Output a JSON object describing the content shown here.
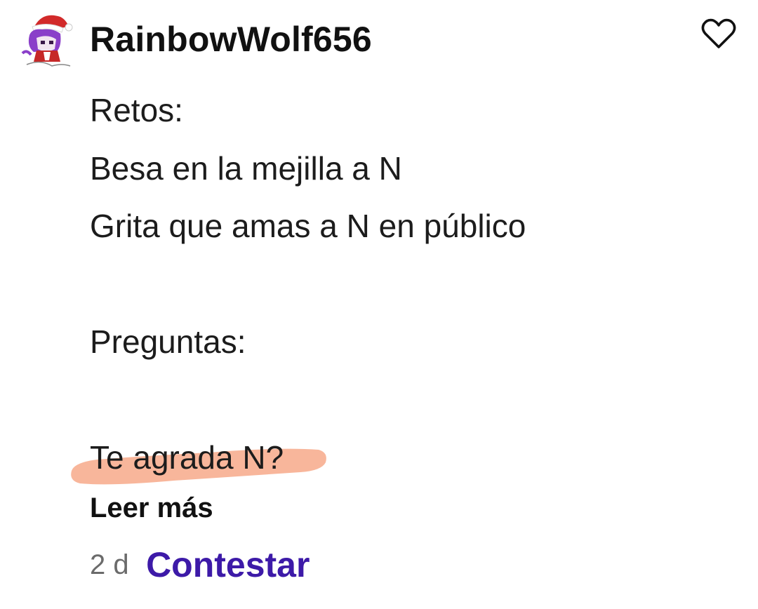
{
  "comment": {
    "author": "RainbowWolf656",
    "avatar_icon": "avatar-character-santa-hat",
    "lines": [
      "Retos:",
      "Besa en la mejilla a N",
      "Grita que amas a N en público",
      "",
      "Preguntas:",
      "",
      "Te agrada N?"
    ],
    "highlight_color": "#f7a98a",
    "read_more_label": "Leer más",
    "timestamp": "2 d",
    "reply_label": "Contestar",
    "reply_color": "#3d1aa8",
    "like_icon": "heart-outline-icon"
  }
}
